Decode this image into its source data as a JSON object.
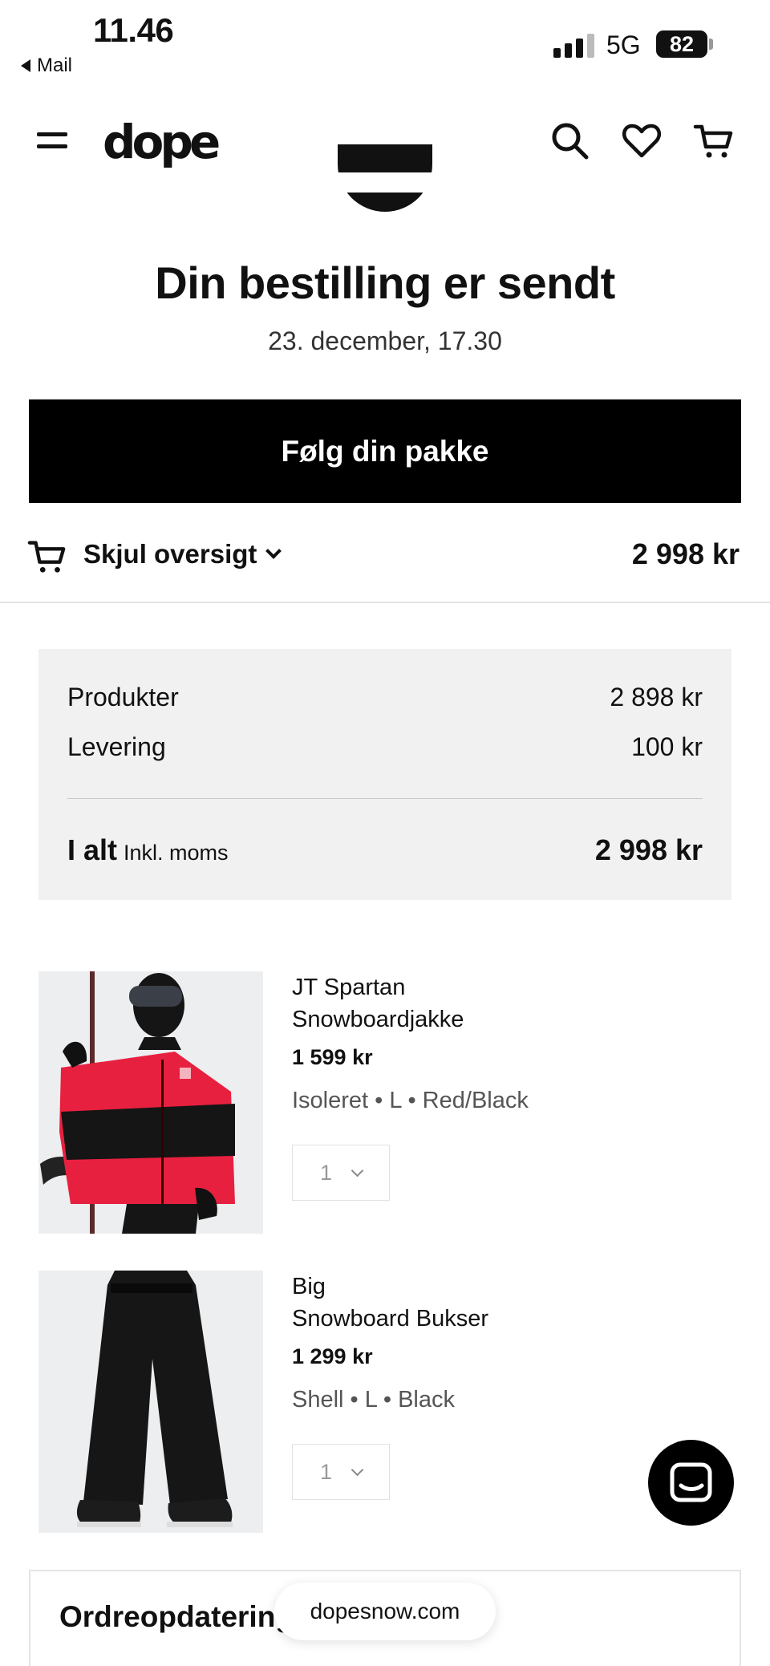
{
  "status_bar": {
    "time": "11.46",
    "back_app": "Mail",
    "network": "5G",
    "battery": "82"
  },
  "header": {
    "logo": "dope",
    "icons": [
      "menu-icon",
      "search-icon",
      "heart-icon",
      "cart-icon"
    ]
  },
  "confirmation": {
    "title": "Din bestilling er sendt",
    "date": "23. december, 17.30",
    "track_button": "Følg din pakke"
  },
  "summary": {
    "toggle_label": "Skjul oversigt",
    "total": "2 998 kr"
  },
  "totals": {
    "products_label": "Produkter",
    "products_value": "2 898 kr",
    "delivery_label": "Levering",
    "delivery_value": "100 kr",
    "total_label": "I alt",
    "total_note": "Inkl. moms",
    "total_value": "2 998 kr"
  },
  "items": [
    {
      "name_line1": "JT Spartan",
      "name_line2": "Snowboardjakke",
      "price": "1 599 kr",
      "variant": "Isoleret • L • Red/Black",
      "qty": "1"
    },
    {
      "name_line1": "Big",
      "name_line2": "Snowboard Bukser",
      "price": "1 299 kr",
      "variant": "Shell • L • Black",
      "qty": "1"
    }
  ],
  "updates": {
    "title": "Ordreopdateringer"
  },
  "browser": {
    "url": "dopesnow.com"
  },
  "colors": {
    "accent": "#000000",
    "jacket_red": "#e8203f",
    "panel": "#f1f1f1"
  }
}
